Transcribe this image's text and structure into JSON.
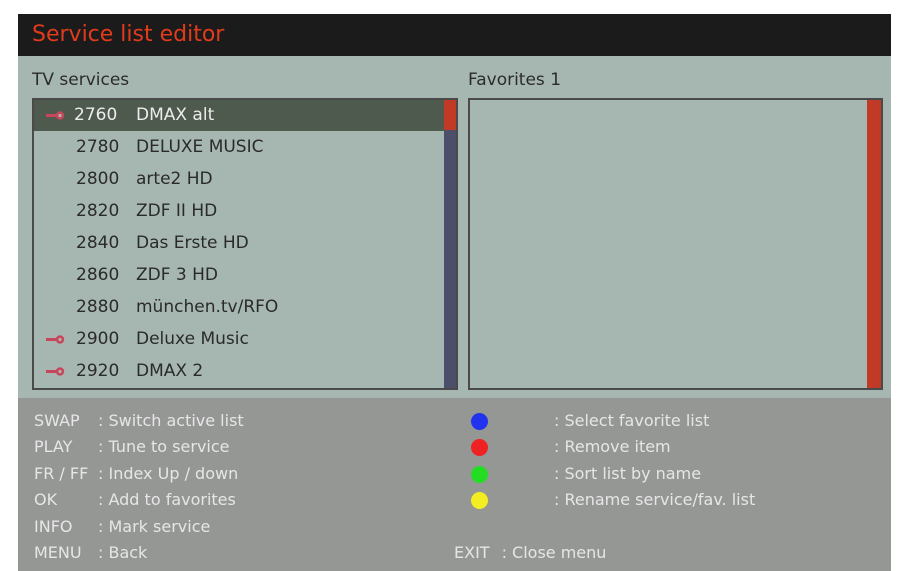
{
  "title": "Service list editor",
  "left_panel": {
    "label": "TV services",
    "rows": [
      {
        "num": "2760",
        "name": "DMAX alt",
        "locked": true,
        "selected": true
      },
      {
        "num": "2780",
        "name": "DELUXE MUSIC",
        "locked": false,
        "selected": false
      },
      {
        "num": "2800",
        "name": "arte2 HD",
        "locked": false,
        "selected": false
      },
      {
        "num": "2820",
        "name": "ZDF II HD",
        "locked": false,
        "selected": false
      },
      {
        "num": "2840",
        "name": "Das Erste HD",
        "locked": false,
        "selected": false
      },
      {
        "num": "2860",
        "name": "ZDF 3 HD",
        "locked": false,
        "selected": false
      },
      {
        "num": "2880",
        "name": "münchen.tv/RFO",
        "locked": false,
        "selected": false
      },
      {
        "num": "2900",
        "name": "Deluxe Music",
        "locked": true,
        "selected": false
      },
      {
        "num": "2920",
        "name": "DMAX 2",
        "locked": true,
        "selected": false
      }
    ]
  },
  "right_panel": {
    "label": "Favorites 1",
    "rows": []
  },
  "help_left": [
    {
      "key": "SWAP",
      "desc": ": Switch active list"
    },
    {
      "key": "PLAY",
      "desc": ": Tune to service"
    },
    {
      "key": "FR / FF",
      "desc": ": Index Up / down"
    },
    {
      "key": "OK",
      "desc": ": Add to favorites"
    },
    {
      "key": "INFO",
      "desc": ": Mark service"
    },
    {
      "key": "MENU",
      "desc": ": Back"
    }
  ],
  "help_right": [
    {
      "color": "#2233ee",
      "icon": "blue-button-icon",
      "desc": ": Select favorite list"
    },
    {
      "color": "#ee2222",
      "icon": "red-button-icon",
      "desc": ": Remove item"
    },
    {
      "color": "#22dd22",
      "icon": "green-button-icon",
      "desc": ": Sort list by name"
    },
    {
      "color": "#f2ee22",
      "icon": "yellow-button-icon",
      "desc": ": Rename service/fav. list"
    }
  ],
  "exit": {
    "key": "EXIT",
    "desc": ": Close menu"
  },
  "colors": {
    "title_bar": "#1b1b1b",
    "title_text": "#e23b1c",
    "panel_bg": "#a6b7b1",
    "selection": "#4e5a4d",
    "scroll_thumb": "#c13a26",
    "scroll_track": "#4b4f69",
    "help_bg": "#959795",
    "lock_icon": "#c8465a"
  }
}
